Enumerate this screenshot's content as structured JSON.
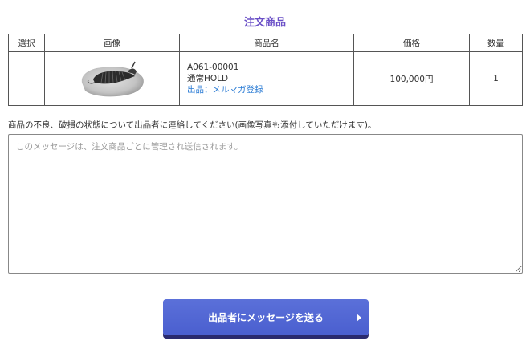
{
  "page": {
    "title": "注文商品"
  },
  "table": {
    "headers": {
      "select": "選択",
      "image": "画像",
      "name": "商品名",
      "price": "価格",
      "quantity": "数量"
    },
    "rows": [
      {
        "item_code": "A061-00001",
        "item_name": "通常HOLD",
        "seller_link": "出品：メルマガ登録",
        "price": "100,000円",
        "quantity": "1",
        "image_icon": "trilobite-fossil-photo"
      }
    ]
  },
  "message": {
    "instruction": "商品の不良、破損の状態について出品者に連絡してください(画像写真も添付していただけます)。",
    "placeholder": "このメッセージは、注文商品ごとに管理され送信されます。",
    "value": ""
  },
  "actions": {
    "send_label": "出品者にメッセージを送る",
    "send_icon": "chevron-right-icon"
  },
  "colors": {
    "title": "#6a4fc7",
    "button": "#4a5fcf",
    "button_shadow": "#2a2a6e",
    "link": "#2a7bd4"
  }
}
